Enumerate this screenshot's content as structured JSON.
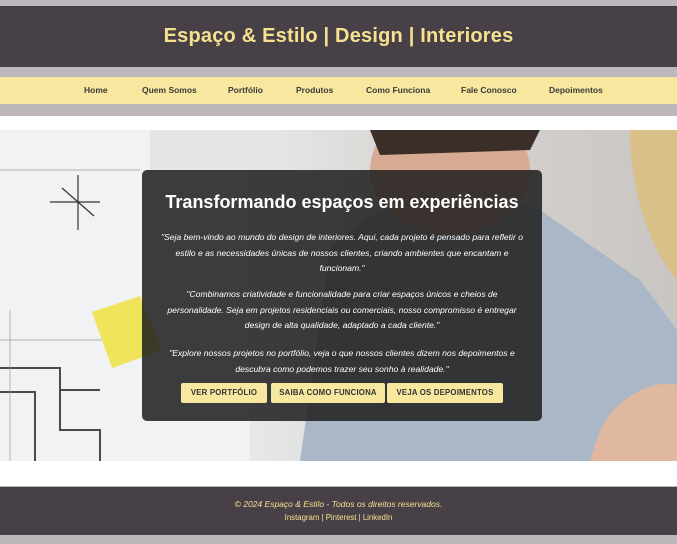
{
  "header": {
    "title": "Espaço & Estilo | Design | Interiores"
  },
  "nav": {
    "items": [
      {
        "label": "Home"
      },
      {
        "label": "Quem Somos"
      },
      {
        "label": "Portfólio"
      },
      {
        "label": "Produtos"
      },
      {
        "label": "Como Funciona"
      },
      {
        "label": "Fale Conosco"
      },
      {
        "label": "Depoimentos"
      }
    ]
  },
  "hero": {
    "title": "Transformando espaços em experiências",
    "paragraphs": [
      "\"Seja bem-vindo ao mundo do design de interiores. Aqui, cada projeto é pensado para refletir o estilo e as necessidades únicas de nossos clientes, criando ambientes que encantam e funcionam.\"",
      "\"Combinamos criatividade e funcionalidade para criar espaços únicos e cheios de personalidade. Seja em projetos residenciais ou comerciais, nosso compromisso é entregar design de alta qualidade, adaptado a cada cliente.\"",
      "\"Explore nossos projetos no portfólio, veja o que nossos clientes dizem nos depoimentos e descubra como podemos trazer seu sonho à realidade.\""
    ],
    "buttons": [
      {
        "label": "VER PORTFÓLIO"
      },
      {
        "label": "SAIBA COMO FUNCIONA"
      },
      {
        "label": "VEJA OS DEPOIMENTOS"
      }
    ]
  },
  "footer": {
    "copyright": "© 2024 Espaço & Estilo - Todos os direitos reservados.",
    "social": [
      {
        "label": "Instagram"
      },
      {
        "label": "Pinterest"
      },
      {
        "label": "LinkedIn"
      }
    ],
    "separator": " | "
  },
  "colors": {
    "header_bg": "#474047",
    "accent": "#f8e79e",
    "title_text": "#f6e18f"
  }
}
